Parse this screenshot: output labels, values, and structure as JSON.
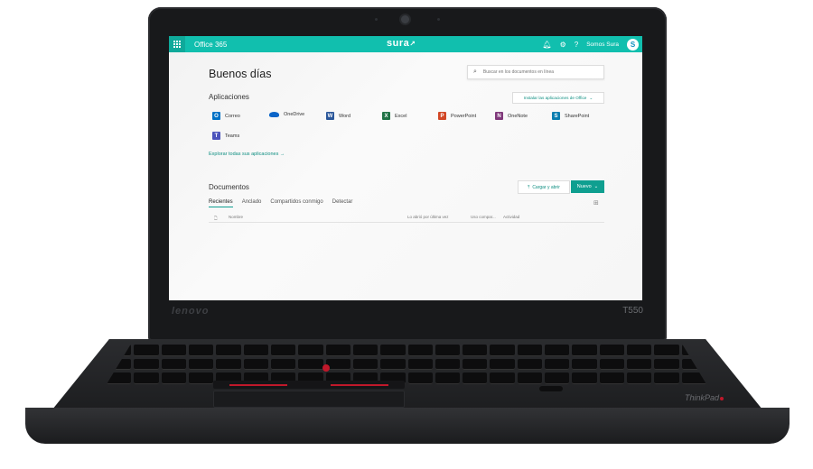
{
  "device": {
    "brand": "lenovo",
    "model": "T550"
  },
  "topbar": {
    "app_title": "Office 365",
    "logo": "sura",
    "user_name": "Somos Sura",
    "avatar_initial": "S",
    "icons": [
      "waffle-icon",
      "bell-icon",
      "gear-icon",
      "help-icon"
    ]
  },
  "greeting": "Buenos días",
  "search": {
    "placeholder": "Buscar en los documentos en línea"
  },
  "apps_section": {
    "title": "Aplicaciones",
    "install_label": "Instalar las aplicaciones de Office",
    "explore_label": "Explorar todas sus aplicaciones",
    "items": [
      {
        "label": "Correo",
        "icon": "outlook-icon",
        "letter": "O",
        "color": "#0072c6"
      },
      {
        "label": "OneDrive",
        "icon": "onedrive-icon",
        "letter": "",
        "color": "#0a64c8"
      },
      {
        "label": "Word",
        "icon": "word-icon",
        "letter": "W",
        "color": "#2b579a"
      },
      {
        "label": "Excel",
        "icon": "excel-icon",
        "letter": "X",
        "color": "#217346"
      },
      {
        "label": "PowerPoint",
        "icon": "powerpoint-icon",
        "letter": "P",
        "color": "#d24726"
      },
      {
        "label": "OneNote",
        "icon": "onenote-icon",
        "letter": "N",
        "color": "#80397b"
      },
      {
        "label": "SharePoint",
        "icon": "sharepoint-icon",
        "letter": "S",
        "color": "#0b7eb0"
      },
      {
        "label": "Teams",
        "icon": "teams-icon",
        "letter": "T",
        "color": "#4b53bc"
      }
    ]
  },
  "documents_section": {
    "title": "Documentos",
    "upload_label": "Cargar y abrir",
    "new_label": "Nuevo",
    "tabs": [
      "Recientes",
      "Anclado",
      "Compartidos conmigo",
      "Detectar"
    ],
    "active_tab": "Recientes",
    "columns": [
      "Nombre",
      "Lo abrió por última vez",
      "Uso compar...",
      "Actividad"
    ]
  },
  "colors": {
    "accent": "#11bfae",
    "accent_dark": "#0f9f90"
  }
}
